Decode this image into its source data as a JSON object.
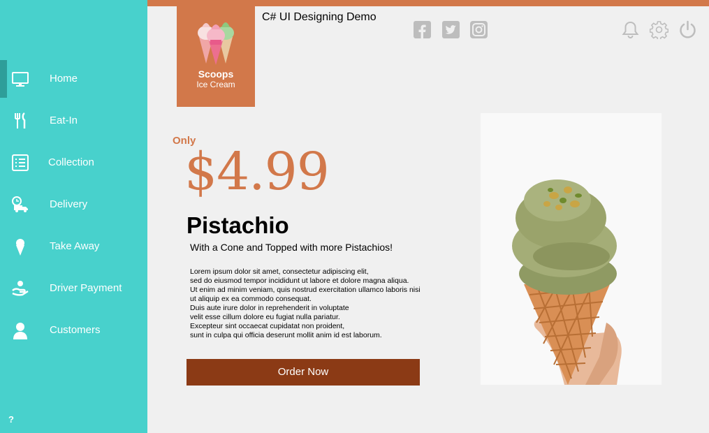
{
  "app": {
    "title": "C# UI Designing Demo"
  },
  "logo": {
    "brand": "Scoops",
    "subtitle": "Ice Cream"
  },
  "sidebar": {
    "items": [
      {
        "label": "Home",
        "icon": "monitor-icon",
        "active": true
      },
      {
        "label": "Eat-In",
        "icon": "fork-knife-icon"
      },
      {
        "label": "Collection",
        "icon": "list-icon"
      },
      {
        "label": "Delivery",
        "icon": "delivery-truck-icon"
      },
      {
        "label": "Take Away",
        "icon": "ice-cream-cone-icon"
      },
      {
        "label": "Driver Payment",
        "icon": "hand-money-icon"
      },
      {
        "label": "Customers",
        "icon": "user-icon"
      }
    ],
    "help": "?"
  },
  "social": [
    "facebook-icon",
    "twitter-icon",
    "instagram-icon"
  ],
  "header_icons": [
    "bell-icon",
    "gear-icon",
    "power-icon"
  ],
  "product": {
    "only_label": "Only",
    "price": "$4.99",
    "name": "Pistachio",
    "tagline": "With a Cone and Topped with more Pistachios!",
    "description": [
      "Lorem ipsum dolor sit amet, consectetur adipiscing elit,",
      "sed do eiusmod tempor incididunt ut labore et dolore magna aliqua.",
      "Ut enim ad minim veniam, quis nostrud exercitation ullamco laboris nisi",
      "ut aliquip ex ea commodo consequat.",
      "Duis aute irure dolor in reprehenderit in voluptate",
      "velit esse cillum dolore eu fugiat nulla pariatur.",
      "Excepteur sint occaecat cupidatat non proident,",
      "sunt in culpa qui officia deserunt mollit anim id est laborum."
    ],
    "order_label": "Order Now"
  },
  "colors": {
    "sidebar": "#48d1cc",
    "accent": "#d2784a",
    "button": "#8b3a15",
    "icon_grey": "#bdbdbd"
  }
}
